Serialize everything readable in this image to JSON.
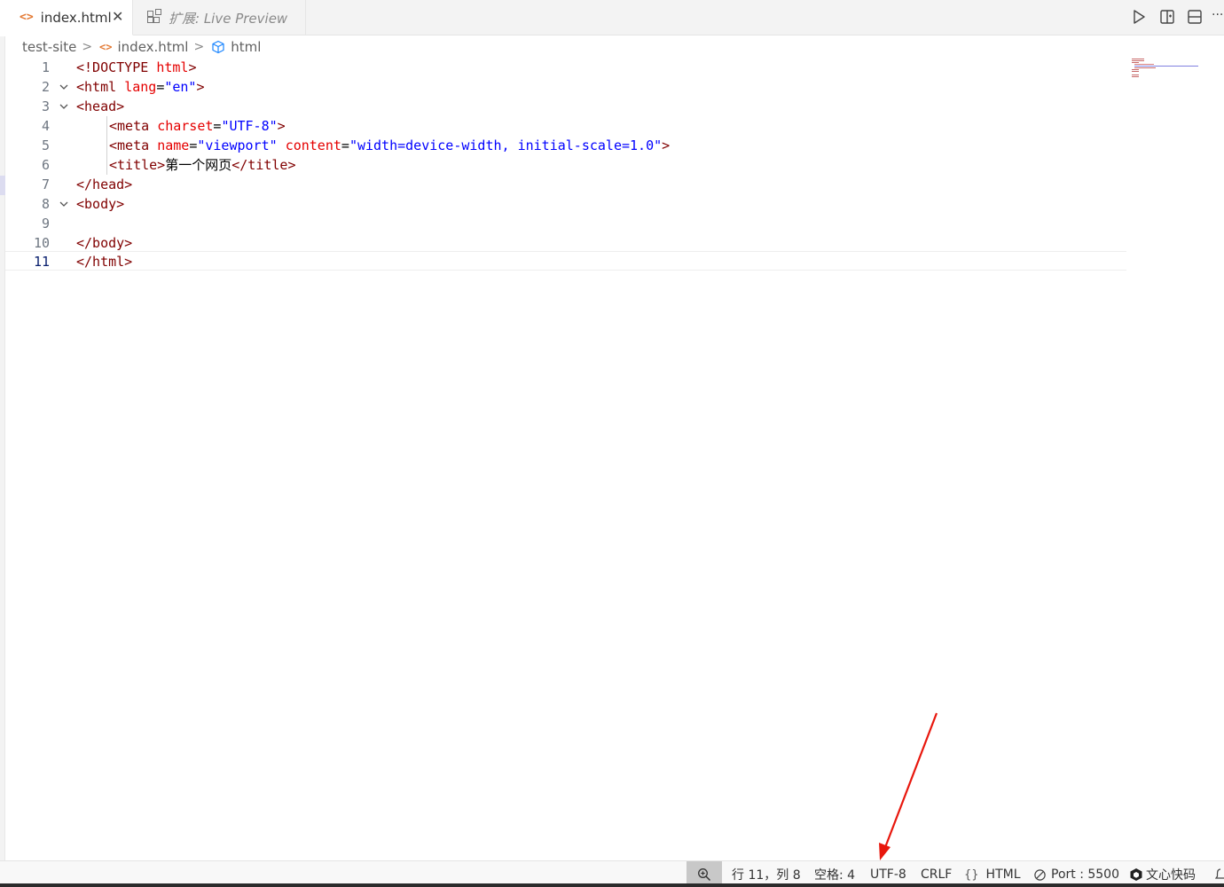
{
  "tabs": [
    {
      "label": "index.html",
      "icon": "html-file-icon",
      "active": true
    },
    {
      "label": "扩展: Live Preview",
      "icon": "extensions-icon",
      "active": false
    }
  ],
  "toolbar": {
    "icons": [
      "run-icon",
      "split-editor-icon",
      "toggle-panel-icon",
      "more-actions-icon"
    ],
    "more_label": "···"
  },
  "breadcrumb": {
    "folder": "test-site",
    "file": "index.html",
    "symbol": "html",
    "sep": ">"
  },
  "editor": {
    "current_line": 11,
    "lines": [
      {
        "n": "1"
      },
      {
        "n": "2"
      },
      {
        "n": "3"
      },
      {
        "n": "4"
      },
      {
        "n": "5"
      },
      {
        "n": "6"
      },
      {
        "n": "7"
      },
      {
        "n": "8"
      },
      {
        "n": "9"
      },
      {
        "n": "10"
      },
      {
        "n": "11"
      }
    ],
    "tokens": {
      "l1": [
        "<!DOCTYPE ",
        "html",
        ">"
      ],
      "l2": [
        "<html ",
        "lang",
        "=",
        "\"en\"",
        ">"
      ],
      "l3": [
        "<head>"
      ],
      "l4": [
        "<meta ",
        "charset",
        "=",
        "\"UTF-8\"",
        ">"
      ],
      "l5": [
        "<meta ",
        "name",
        "=",
        "\"viewport\"",
        " ",
        "content",
        "=",
        "\"width=device-width, initial-scale=1.0\"",
        ">"
      ],
      "l6": [
        "<title>",
        "第一个网页",
        "</title>"
      ],
      "l7": [
        "</head>"
      ],
      "l8": [
        "<body>"
      ],
      "l10": [
        "</body>"
      ],
      "l11": [
        "</html>"
      ]
    }
  },
  "statusbar": {
    "zoom_icon": "zoom-icon",
    "position": "行 11，列 8",
    "indent": "空格: 4",
    "encoding": "UTF-8",
    "eol": "CRLF",
    "lang_icon": "{}",
    "language": "HTML",
    "port": "Port : 5500",
    "assistant": "文心快码"
  },
  "colors": {
    "tag": "#800000",
    "attribute": "#e50000",
    "string": "#0000ff",
    "text": "#000000",
    "annotation_arrow": "#e8170d"
  }
}
